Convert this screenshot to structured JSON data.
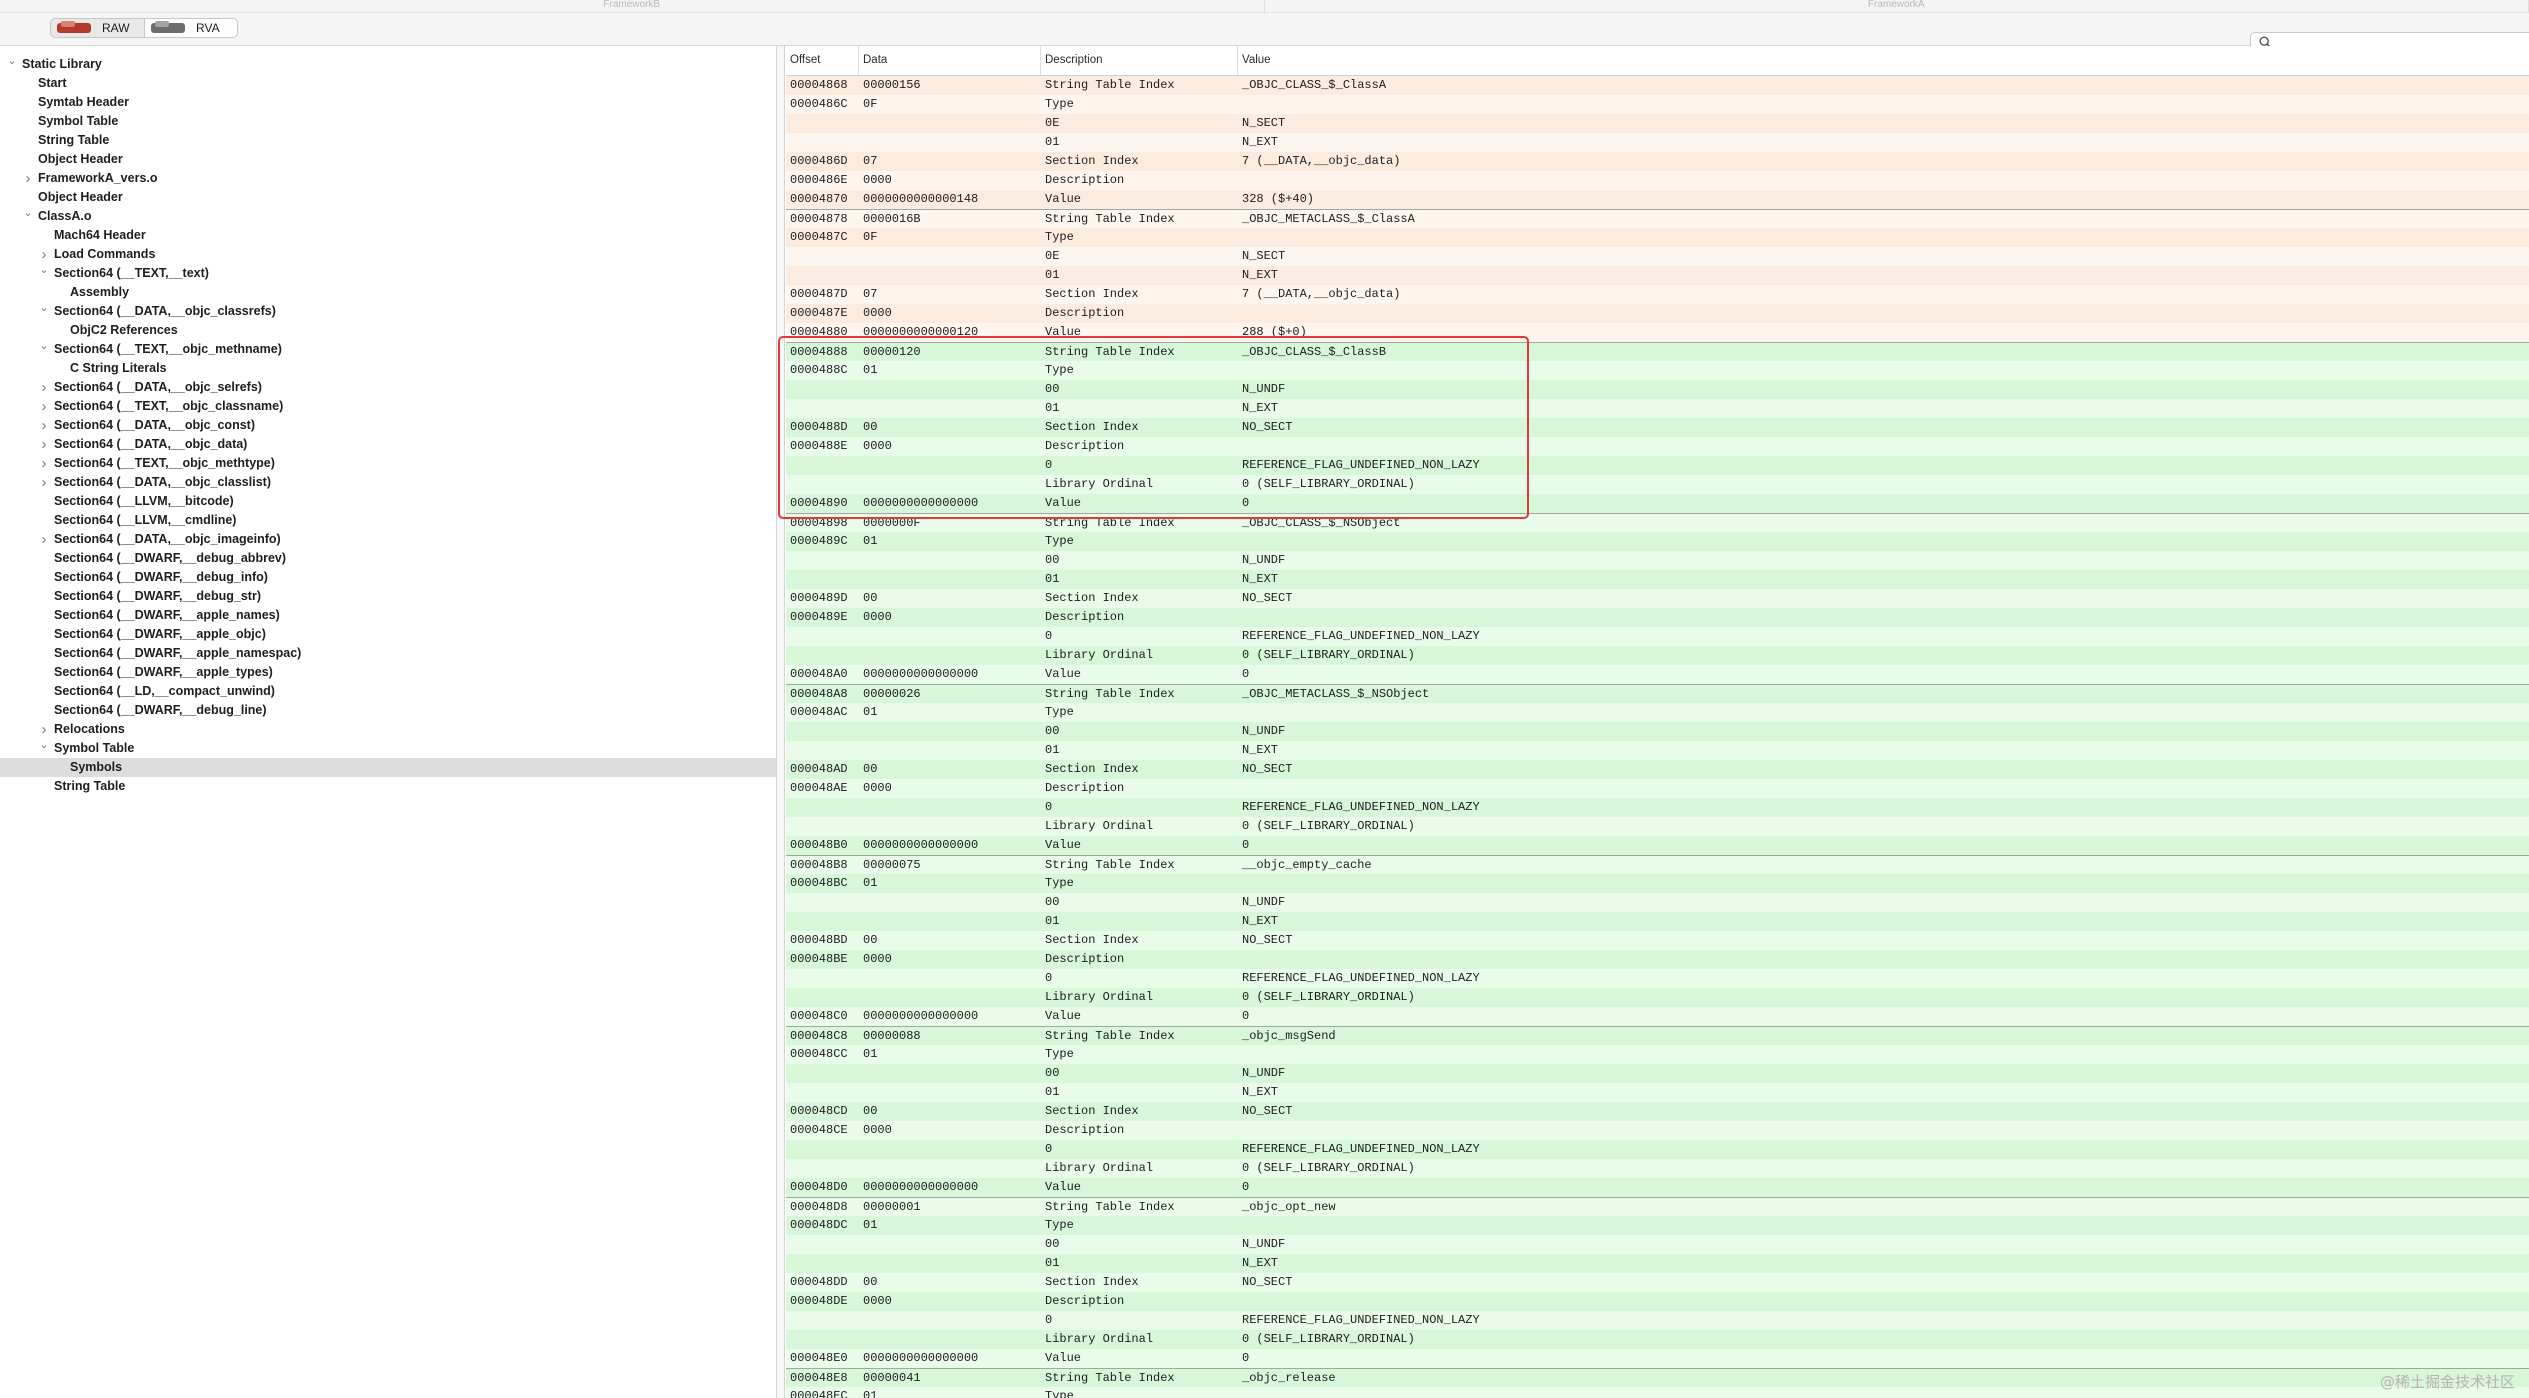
{
  "window": {
    "tabs": [
      "FrameworkB",
      "FrameworkA"
    ]
  },
  "toolbar": {
    "raw_label": "RAW",
    "rva_label": "RVA",
    "search_placeholder": "",
    "colors": {
      "raw_icon": "#c0392b",
      "rva_icon": "#7a7a7a"
    }
  },
  "sidebar": {
    "items": [
      {
        "label": "Static Library",
        "level": 0,
        "disclosure": "open"
      },
      {
        "label": "Start",
        "level": 1,
        "disclosure": "none"
      },
      {
        "label": "Symtab Header",
        "level": 1,
        "disclosure": "none"
      },
      {
        "label": "Symbol Table",
        "level": 1,
        "disclosure": "none"
      },
      {
        "label": "String Table",
        "level": 1,
        "disclosure": "none"
      },
      {
        "label": "Object Header",
        "level": 1,
        "disclosure": "none"
      },
      {
        "label": "FrameworkA_vers.o",
        "level": 1,
        "disclosure": "closed"
      },
      {
        "label": "Object Header",
        "level": 1,
        "disclosure": "none"
      },
      {
        "label": "ClassA.o",
        "level": 1,
        "disclosure": "open"
      },
      {
        "label": "Mach64 Header",
        "level": 2,
        "disclosure": "none"
      },
      {
        "label": "Load Commands",
        "level": 2,
        "disclosure": "closed"
      },
      {
        "label": "Section64 (__TEXT,__text)",
        "level": 2,
        "disclosure": "open"
      },
      {
        "label": "Assembly",
        "level": 3,
        "disclosure": "none"
      },
      {
        "label": "Section64 (__DATA,__objc_classrefs)",
        "level": 2,
        "disclosure": "open"
      },
      {
        "label": "ObjC2 References",
        "level": 3,
        "disclosure": "none"
      },
      {
        "label": "Section64 (__TEXT,__objc_methname)",
        "level": 2,
        "disclosure": "open"
      },
      {
        "label": "C String Literals",
        "level": 3,
        "disclosure": "none"
      },
      {
        "label": "Section64 (__DATA,__objc_selrefs)",
        "level": 2,
        "disclosure": "closed"
      },
      {
        "label": "Section64 (__TEXT,__objc_classname)",
        "level": 2,
        "disclosure": "closed"
      },
      {
        "label": "Section64 (__DATA,__objc_const)",
        "level": 2,
        "disclosure": "closed"
      },
      {
        "label": "Section64 (__DATA,__objc_data)",
        "level": 2,
        "disclosure": "closed"
      },
      {
        "label": "Section64 (__TEXT,__objc_methtype)",
        "level": 2,
        "disclosure": "closed"
      },
      {
        "label": "Section64 (__DATA,__objc_classlist)",
        "level": 2,
        "disclosure": "closed"
      },
      {
        "label": "Section64 (__LLVM,__bitcode)",
        "level": 2,
        "disclosure": "none"
      },
      {
        "label": "Section64 (__LLVM,__cmdline)",
        "level": 2,
        "disclosure": "none"
      },
      {
        "label": "Section64 (__DATA,__objc_imageinfo)",
        "level": 2,
        "disclosure": "closed"
      },
      {
        "label": "Section64 (__DWARF,__debug_abbrev)",
        "level": 2,
        "disclosure": "none"
      },
      {
        "label": "Section64 (__DWARF,__debug_info)",
        "level": 2,
        "disclosure": "none"
      },
      {
        "label": "Section64 (__DWARF,__debug_str)",
        "level": 2,
        "disclosure": "none"
      },
      {
        "label": "Section64 (__DWARF,__apple_names)",
        "level": 2,
        "disclosure": "none"
      },
      {
        "label": "Section64 (__DWARF,__apple_objc)",
        "level": 2,
        "disclosure": "none"
      },
      {
        "label": "Section64 (__DWARF,__apple_namespac)",
        "level": 2,
        "disclosure": "none"
      },
      {
        "label": "Section64 (__DWARF,__apple_types)",
        "level": 2,
        "disclosure": "none"
      },
      {
        "label": "Section64 (__LD,__compact_unwind)",
        "level": 2,
        "disclosure": "none"
      },
      {
        "label": "Section64 (__DWARF,__debug_line)",
        "level": 2,
        "disclosure": "none"
      },
      {
        "label": "Relocations",
        "level": 2,
        "disclosure": "closed"
      },
      {
        "label": "Symbol Table",
        "level": 2,
        "disclosure": "open"
      },
      {
        "label": "Symbols",
        "level": 3,
        "disclosure": "none",
        "selected": true
      },
      {
        "label": "String Table",
        "level": 2,
        "disclosure": "none"
      }
    ]
  },
  "table": {
    "headers": [
      "Offset",
      "Data",
      "Description",
      "Value"
    ],
    "groups": [
      {
        "color": "peach",
        "rows": [
          [
            "00004868",
            "00000156",
            "String Table Index",
            "_OBJC_CLASS_$_ClassA"
          ],
          [
            "0000486C",
            "0F",
            "Type",
            ""
          ],
          [
            "",
            "",
            "0E",
            "N_SECT"
          ],
          [
            "",
            "",
            "01",
            "N_EXT"
          ],
          [
            "0000486D",
            "07",
            "Section Index",
            "7 (__DATA,__objc_data)"
          ],
          [
            "0000486E",
            "0000",
            "Description",
            ""
          ],
          [
            "00004870",
            "0000000000000148",
            "Value",
            "328 ($+40)"
          ]
        ]
      },
      {
        "color": "peach",
        "rows": [
          [
            "00004878",
            "0000016B",
            "String Table Index",
            "_OBJC_METACLASS_$_ClassA"
          ],
          [
            "0000487C",
            "0F",
            "Type",
            ""
          ],
          [
            "",
            "",
            "0E",
            "N_SECT"
          ],
          [
            "",
            "",
            "01",
            "N_EXT"
          ],
          [
            "0000487D",
            "07",
            "Section Index",
            "7 (__DATA,__objc_data)"
          ],
          [
            "0000487E",
            "0000",
            "Description",
            ""
          ],
          [
            "00004880",
            "0000000000000120",
            "Value",
            "288 ($+0)"
          ]
        ]
      },
      {
        "color": "green",
        "rows": [
          [
            "00004888",
            "00000120",
            "String Table Index",
            "_OBJC_CLASS_$_ClassB"
          ],
          [
            "0000488C",
            "01",
            "Type",
            ""
          ],
          [
            "",
            "",
            "00",
            "N_UNDF"
          ],
          [
            "",
            "",
            "01",
            "N_EXT"
          ],
          [
            "0000488D",
            "00",
            "Section Index",
            "NO_SECT"
          ],
          [
            "0000488E",
            "0000",
            "Description",
            ""
          ],
          [
            "",
            "",
            "0",
            "REFERENCE_FLAG_UNDEFINED_NON_LAZY"
          ],
          [
            "",
            "",
            "Library Ordinal",
            "0 (SELF_LIBRARY_ORDINAL)"
          ],
          [
            "00004890",
            "0000000000000000",
            "Value",
            "0"
          ]
        ]
      },
      {
        "color": "green",
        "rows": [
          [
            "00004898",
            "0000000F",
            "String Table Index",
            "_OBJC_CLASS_$_NSObject"
          ],
          [
            "0000489C",
            "01",
            "Type",
            ""
          ],
          [
            "",
            "",
            "00",
            "N_UNDF"
          ],
          [
            "",
            "",
            "01",
            "N_EXT"
          ],
          [
            "0000489D",
            "00",
            "Section Index",
            "NO_SECT"
          ],
          [
            "0000489E",
            "0000",
            "Description",
            ""
          ],
          [
            "",
            "",
            "0",
            "REFERENCE_FLAG_UNDEFINED_NON_LAZY"
          ],
          [
            "",
            "",
            "Library Ordinal",
            "0 (SELF_LIBRARY_ORDINAL)"
          ],
          [
            "000048A0",
            "0000000000000000",
            "Value",
            "0"
          ]
        ]
      },
      {
        "color": "green",
        "rows": [
          [
            "000048A8",
            "00000026",
            "String Table Index",
            "_OBJC_METACLASS_$_NSObject"
          ],
          [
            "000048AC",
            "01",
            "Type",
            ""
          ],
          [
            "",
            "",
            "00",
            "N_UNDF"
          ],
          [
            "",
            "",
            "01",
            "N_EXT"
          ],
          [
            "000048AD",
            "00",
            "Section Index",
            "NO_SECT"
          ],
          [
            "000048AE",
            "0000",
            "Description",
            ""
          ],
          [
            "",
            "",
            "0",
            "REFERENCE_FLAG_UNDEFINED_NON_LAZY"
          ],
          [
            "",
            "",
            "Library Ordinal",
            "0 (SELF_LIBRARY_ORDINAL)"
          ],
          [
            "000048B0",
            "0000000000000000",
            "Value",
            "0"
          ]
        ]
      },
      {
        "color": "green",
        "rows": [
          [
            "000048B8",
            "00000075",
            "String Table Index",
            "__objc_empty_cache"
          ],
          [
            "000048BC",
            "01",
            "Type",
            ""
          ],
          [
            "",
            "",
            "00",
            "N_UNDF"
          ],
          [
            "",
            "",
            "01",
            "N_EXT"
          ],
          [
            "000048BD",
            "00",
            "Section Index",
            "NO_SECT"
          ],
          [
            "000048BE",
            "0000",
            "Description",
            ""
          ],
          [
            "",
            "",
            "0",
            "REFERENCE_FLAG_UNDEFINED_NON_LAZY"
          ],
          [
            "",
            "",
            "Library Ordinal",
            "0 (SELF_LIBRARY_ORDINAL)"
          ],
          [
            "000048C0",
            "0000000000000000",
            "Value",
            "0"
          ]
        ]
      },
      {
        "color": "green",
        "rows": [
          [
            "000048C8",
            "00000088",
            "String Table Index",
            "_objc_msgSend"
          ],
          [
            "000048CC",
            "01",
            "Type",
            ""
          ],
          [
            "",
            "",
            "00",
            "N_UNDF"
          ],
          [
            "",
            "",
            "01",
            "N_EXT"
          ],
          [
            "000048CD",
            "00",
            "Section Index",
            "NO_SECT"
          ],
          [
            "000048CE",
            "0000",
            "Description",
            ""
          ],
          [
            "",
            "",
            "0",
            "REFERENCE_FLAG_UNDEFINED_NON_LAZY"
          ],
          [
            "",
            "",
            "Library Ordinal",
            "0 (SELF_LIBRARY_ORDINAL)"
          ],
          [
            "000048D0",
            "0000000000000000",
            "Value",
            "0"
          ]
        ]
      },
      {
        "color": "green",
        "rows": [
          [
            "000048D8",
            "00000001",
            "String Table Index",
            "_objc_opt_new"
          ],
          [
            "000048DC",
            "01",
            "Type",
            ""
          ],
          [
            "",
            "",
            "00",
            "N_UNDF"
          ],
          [
            "",
            "",
            "01",
            "N_EXT"
          ],
          [
            "000048DD",
            "00",
            "Section Index",
            "NO_SECT"
          ],
          [
            "000048DE",
            "0000",
            "Description",
            ""
          ],
          [
            "",
            "",
            "0",
            "REFERENCE_FLAG_UNDEFINED_NON_LAZY"
          ],
          [
            "",
            "",
            "Library Ordinal",
            "0 (SELF_LIBRARY_ORDINAL)"
          ],
          [
            "000048E0",
            "0000000000000000",
            "Value",
            "0"
          ]
        ]
      },
      {
        "color": "green",
        "rows": [
          [
            "000048E8",
            "00000041",
            "String Table Index",
            "_objc_release"
          ],
          [
            "000048EC",
            "01",
            "Type",
            ""
          ]
        ]
      }
    ],
    "highlight_color": "#e03a3a"
  },
  "watermark": "@稀土掘金技术社区"
}
